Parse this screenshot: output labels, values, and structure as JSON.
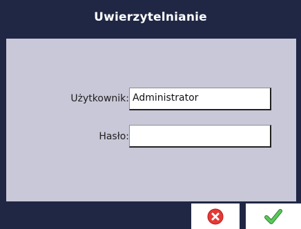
{
  "dialog": {
    "title": "Uwierzytelnianie"
  },
  "form": {
    "user_label": "Użytkownik:",
    "user_value": "Administrator",
    "password_label": "Hasło:",
    "password_value": ""
  },
  "buttons": {
    "cancel_icon": "cancel-icon",
    "confirm_icon": "check-icon"
  },
  "colors": {
    "header": "#1f2744",
    "panel": "#c9c8d8",
    "cancel": "#e53935",
    "confirm": "#49b14a"
  }
}
